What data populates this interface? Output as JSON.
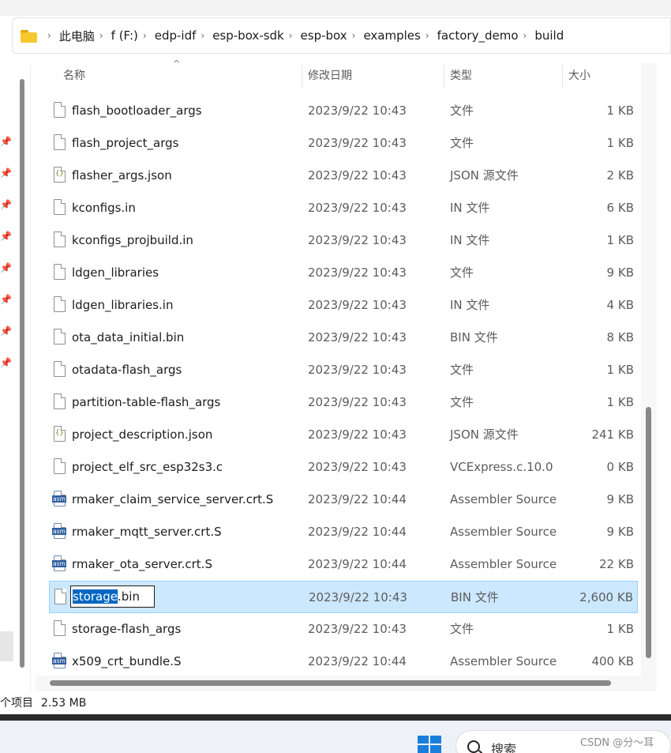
{
  "breadcrumb": [
    "此电脑",
    "f (F:)",
    "edp-idf",
    "esp-box-sdk",
    "esp-box",
    "examples",
    "factory_demo",
    "build"
  ],
  "columns": {
    "name": "名称",
    "date": "修改日期",
    "type": "类型",
    "size": "大小"
  },
  "files": [
    {
      "name": "flash_bootloader_args",
      "date": "2023/9/22 10:43",
      "type": "文件",
      "size": "1 KB",
      "icon": "file"
    },
    {
      "name": "flash_project_args",
      "date": "2023/9/22 10:43",
      "type": "文件",
      "size": "1 KB",
      "icon": "file"
    },
    {
      "name": "flasher_args.json",
      "date": "2023/9/22 10:43",
      "type": "JSON 源文件",
      "size": "2 KB",
      "icon": "json"
    },
    {
      "name": "kconfigs.in",
      "date": "2023/9/22 10:43",
      "type": "IN 文件",
      "size": "6 KB",
      "icon": "file"
    },
    {
      "name": "kconfigs_projbuild.in",
      "date": "2023/9/22 10:43",
      "type": "IN 文件",
      "size": "1 KB",
      "icon": "file"
    },
    {
      "name": "ldgen_libraries",
      "date": "2023/9/22 10:43",
      "type": "文件",
      "size": "9 KB",
      "icon": "file"
    },
    {
      "name": "ldgen_libraries.in",
      "date": "2023/9/22 10:43",
      "type": "IN 文件",
      "size": "4 KB",
      "icon": "file"
    },
    {
      "name": "ota_data_initial.bin",
      "date": "2023/9/22 10:43",
      "type": "BIN 文件",
      "size": "8 KB",
      "icon": "file"
    },
    {
      "name": "otadata-flash_args",
      "date": "2023/9/22 10:43",
      "type": "文件",
      "size": "1 KB",
      "icon": "file"
    },
    {
      "name": "partition-table-flash_args",
      "date": "2023/9/22 10:43",
      "type": "文件",
      "size": "1 KB",
      "icon": "file"
    },
    {
      "name": "project_description.json",
      "date": "2023/9/22 10:43",
      "type": "JSON 源文件",
      "size": "241 KB",
      "icon": "json"
    },
    {
      "name": "project_elf_src_esp32s3.c",
      "date": "2023/9/22 10:43",
      "type": "VCExpress.c.10.0",
      "size": "0 KB",
      "icon": "file"
    },
    {
      "name": "rmaker_claim_service_server.crt.S",
      "date": "2023/9/22 10:44",
      "type": "Assembler Source",
      "size": "9 KB",
      "icon": "asm"
    },
    {
      "name": "rmaker_mqtt_server.crt.S",
      "date": "2023/9/22 10:44",
      "type": "Assembler Source",
      "size": "9 KB",
      "icon": "asm"
    },
    {
      "name": "rmaker_ota_server.crt.S",
      "date": "2023/9/22 10:44",
      "type": "Assembler Source",
      "size": "22 KB",
      "icon": "asm"
    },
    {
      "name": "storage.bin",
      "date": "2023/9/22 10:43",
      "type": "BIN 文件",
      "size": "2,600 KB",
      "icon": "file",
      "selected": true,
      "rename_selected": "storage",
      "rename_rest": ".bin"
    },
    {
      "name": "storage-flash_args",
      "date": "2023/9/22 10:43",
      "type": "文件",
      "size": "1 KB",
      "icon": "file"
    },
    {
      "name": "x509_crt_bundle.S",
      "date": "2023/9/22 10:44",
      "type": "Assembler Source",
      "size": "400 KB",
      "icon": "asm"
    }
  ],
  "icons": {
    "json_glyph": "{}",
    "asm_glyph": "asm",
    "pin": "📌"
  },
  "status": {
    "items": "个项目",
    "size": "2.53 MB"
  },
  "taskbar": {
    "search_label": "搜索",
    "watermark": "CSDN @分～耳"
  },
  "colors": {
    "selection_bg": "#cce8ff",
    "selection_border": "#99d1ff",
    "accent": "#0067c0",
    "folder": "#f8c62f"
  }
}
